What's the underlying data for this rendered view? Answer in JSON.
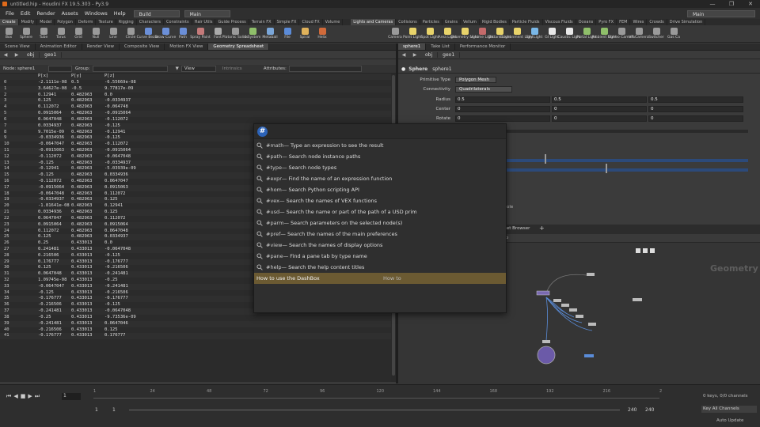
{
  "window": {
    "title": "untitled.hip - Houdini FX 19.5.303 - Py3.9",
    "controls": [
      "—",
      "❐",
      "✕"
    ]
  },
  "menu": {
    "items": [
      "File",
      "Edit",
      "Render",
      "Assets",
      "Windows",
      "Help"
    ],
    "desktop_left": "Build",
    "desktop_mid": "Main",
    "desktop_right": "Main"
  },
  "shelf_tabs_left": [
    "Create",
    "Modify",
    "Model",
    "Polygon",
    "Deform",
    "Texture",
    "Rigging",
    "Characters",
    "Constraints",
    "Hair Utils",
    "Guide Process",
    "Terrain FX",
    "Simple FX",
    "Cloud FX",
    "Volume"
  ],
  "shelf_tabs_right": [
    "Lights and Cameras",
    "Collisions",
    "Particles",
    "Grains",
    "Vellum",
    "Rigid Bodies",
    "Particle Fluids",
    "Viscous Fluids",
    "Oceans",
    "Pyro FX",
    "FEM",
    "Wires",
    "Crowds",
    "Drive Simulation"
  ],
  "tools_left": [
    {
      "label": "Box",
      "color": "#9a9a9a"
    },
    {
      "label": "Sphere",
      "color": "#9a9a9a"
    },
    {
      "label": "Tube",
      "color": "#9a9a9a"
    },
    {
      "label": "Torus",
      "color": "#9a9a9a"
    },
    {
      "label": "Grid",
      "color": "#9a9a9a"
    },
    {
      "label": "Null",
      "color": "#9a9a9a"
    },
    {
      "label": "Line",
      "color": "#9a9a9a"
    },
    {
      "label": "Circle",
      "color": "#9a9a9a"
    },
    {
      "label": "Curve Bezier",
      "color": "#6b8fd8"
    },
    {
      "label": "Draw Curve",
      "color": "#6b8fd8"
    },
    {
      "label": "Path",
      "color": "#6b8fd8"
    },
    {
      "label": "Spray Paint",
      "color": "#c47a7a"
    },
    {
      "label": "Font",
      "color": "#aaaaaa"
    },
    {
      "label": "Platonic Solids",
      "color": "#9a9a9a"
    },
    {
      "label": "L-System",
      "color": "#8fbf6a"
    },
    {
      "label": "Metaball",
      "color": "#7aa6d8"
    },
    {
      "label": "File",
      "color": "#5b8bd8"
    },
    {
      "label": "Spiral",
      "color": "#e0b25b"
    },
    {
      "label": "Helix",
      "color": "#d06a3a"
    }
  ],
  "tools_right": [
    {
      "label": "Camera",
      "color": "#9a9a9a"
    },
    {
      "label": "Point Light",
      "color": "#e8d36a"
    },
    {
      "label": "Spot Light",
      "color": "#e8d36a"
    },
    {
      "label": "Area Light",
      "color": "#e8d36a"
    },
    {
      "label": "Geometry Light",
      "color": "#e8d36a"
    },
    {
      "label": "Volume Light",
      "color": "#c46a6a"
    },
    {
      "label": "Distant Light",
      "color": "#e8d36a"
    },
    {
      "label": "Environment Light",
      "color": "#e8d36a"
    },
    {
      "label": "Sky Light",
      "color": "#7ab8e8"
    },
    {
      "label": "GI Light",
      "color": "#e8e8e8"
    },
    {
      "label": "Caustic Light",
      "color": "#e8e8e8"
    },
    {
      "label": "Portal Light",
      "color": "#8fbf6a"
    },
    {
      "label": "Ambient Light",
      "color": "#8fbf6a"
    },
    {
      "label": "Stereo Camera",
      "color": "#9a9a9a"
    },
    {
      "label": "VR Camera",
      "color": "#9a9a9a"
    },
    {
      "label": "Switcher",
      "color": "#9a9a9a"
    },
    {
      "label": "Gas Ca",
      "color": "#9a9a9a"
    }
  ],
  "left_pane": {
    "tabs": [
      "Scene View",
      "Animation Editor",
      "Render View",
      "Composite View",
      "Motion FX View",
      "Geometry Spreadsheet"
    ],
    "path": [
      "obj",
      "geo1"
    ],
    "node_label": "Node: sphere1",
    "group_label": "Group:",
    "view_label": "View",
    "intrinsics_label": "Intrinsics",
    "attributes_label": "Attributes:"
  },
  "spreadsheet": {
    "headers": [
      "",
      "P[x]",
      "P[y]",
      "P[z]"
    ],
    "rows": [
      [
        "0",
        "-2.1111e-08",
        "0.5",
        "-6.55669e-08"
      ],
      [
        "1",
        "3.64627e-08",
        "-0.5",
        "9.77817e-09"
      ],
      [
        "2",
        "0.12941",
        "0.482963",
        "0.0"
      ],
      [
        "3",
        "0.125",
        "0.482963",
        "-0.0334937"
      ],
      [
        "4",
        "0.112072",
        "0.482963",
        "-0.064748"
      ],
      [
        "5",
        "0.0915064",
        "0.482963",
        "-0.0915064"
      ],
      [
        "6",
        "0.0647048",
        "0.482963",
        "-0.112072"
      ],
      [
        "7",
        "0.0334937",
        "0.482963",
        "-0.125"
      ],
      [
        "8",
        "9.7015e-09",
        "0.482963",
        "-0.12941"
      ],
      [
        "9",
        "-0.0334936",
        "0.482963",
        "-0.125"
      ],
      [
        "10",
        "-0.0647047",
        "0.482963",
        "-0.112072"
      ],
      [
        "11",
        "-0.0915063",
        "0.482963",
        "-0.0915064"
      ],
      [
        "12",
        "-0.112072",
        "0.482963",
        "-0.0647048"
      ],
      [
        "13",
        "-0.125",
        "0.482963",
        "-0.0334937"
      ],
      [
        "14",
        "-0.12941",
        "0.482963",
        "-5.03939e-09"
      ],
      [
        "15",
        "-0.125",
        "0.482963",
        "0.0334936"
      ],
      [
        "16",
        "-0.112072",
        "0.482963",
        "0.0647047"
      ],
      [
        "17",
        "-0.0915064",
        "0.482963",
        "0.0915063"
      ],
      [
        "18",
        "-0.0647048",
        "0.482963",
        "0.112072"
      ],
      [
        "19",
        "-0.0334937",
        "0.482963",
        "0.125"
      ],
      [
        "20",
        "-1.81641e-08",
        "0.482963",
        "0.12941"
      ],
      [
        "21",
        "0.0334936",
        "0.482963",
        "0.125"
      ],
      [
        "22",
        "0.0647047",
        "0.482963",
        "0.112072"
      ],
      [
        "23",
        "0.0915064",
        "0.482963",
        "0.0915064"
      ],
      [
        "24",
        "0.112072",
        "0.482963",
        "0.0647048"
      ],
      [
        "25",
        "0.125",
        "0.482963",
        "0.0334937"
      ],
      [
        "26",
        "0.25",
        "0.433013",
        "0.0"
      ],
      [
        "27",
        "0.241481",
        "0.433013",
        "-0.0647048"
      ],
      [
        "28",
        "0.216506",
        "0.433013",
        "-0.125"
      ],
      [
        "29",
        "0.176777",
        "0.433013",
        "-0.176777"
      ],
      [
        "30",
        "0.125",
        "0.433013",
        "-0.216506"
      ],
      [
        "31",
        "0.0647048",
        "0.433013",
        "-0.241481"
      ],
      [
        "32",
        "1.09745e-08",
        "0.433013",
        "-0.25"
      ],
      [
        "33",
        "-0.0647047",
        "0.433013",
        "-0.241481"
      ],
      [
        "34",
        "-0.125",
        "0.433013",
        "-0.216506"
      ],
      [
        "35",
        "-0.176777",
        "0.433013",
        "-0.176777"
      ],
      [
        "36",
        "-0.216506",
        "0.433013",
        "-0.125"
      ],
      [
        "37",
        "-0.241481",
        "0.433013",
        "-0.0647048"
      ],
      [
        "38",
        "-0.25",
        "0.433013",
        "-9.73536e-09"
      ],
      [
        "39",
        "-0.241481",
        "0.433013",
        "0.0647046"
      ],
      [
        "40",
        "-0.216506",
        "0.433013",
        "0.125"
      ],
      [
        "41",
        "-0.176777",
        "0.433013",
        "0.176777"
      ]
    ]
  },
  "right_pane": {
    "tabs": [
      "sphere1",
      "Take List",
      "Performance Monitor"
    ],
    "path": [
      "obj",
      "geo1"
    ],
    "node_type": "Sphere",
    "node_name": "sphere1",
    "parms": {
      "primitive_type_label": "Primitive Type",
      "primitive_type_value": "Polygon Mesh",
      "connectivity_label": "Connectivity",
      "connectivity_value": "Quadrilaterals",
      "radius_label": "Radius",
      "radius": [
        "0.5",
        "0.5",
        "0.5"
      ],
      "center_label": "Center",
      "center": [
        "0",
        "0",
        "0"
      ],
      "rotate_label": "Rotate",
      "rotate": [
        "0",
        "0",
        "0"
      ],
      "partial_label": "ole"
    }
  },
  "network": {
    "tab_label": "set Browser",
    "path_label": "lp",
    "context_label": "Geometry"
  },
  "timeline": {
    "frame": "1",
    "ticks": [
      "1",
      "24",
      "48",
      "72",
      "96",
      "120",
      "144",
      "168",
      "192",
      "216",
      "2"
    ],
    "start": "1",
    "start2": "1",
    "end": "240",
    "end2": "240",
    "keys_label": "0 keys, 0/0 channels",
    "channels_label": "Key All Channels",
    "auto_update": "Auto Update"
  },
  "dashbox": {
    "query": "",
    "items": [
      {
        "key": "#math",
        "text": " — Type an expression to see the result"
      },
      {
        "key": "#path",
        "text": " — Search node instance paths"
      },
      {
        "key": "#type",
        "text": " — Search node types"
      },
      {
        "key": "#expr",
        "text": " — Find the name of an expression function"
      },
      {
        "key": "#hom",
        "text": " — Search Python scripting API"
      },
      {
        "key": "#vex",
        "text": " — Search the names of VEX functions"
      },
      {
        "key": "#usd",
        "text": " — Search the name or part of the path of a USD prim"
      },
      {
        "key": "#parm",
        "text": " — Search parameters on the selected node(s)"
      },
      {
        "key": "#pref",
        "text": " — Search the names of the main preferences"
      },
      {
        "key": "#view",
        "text": " — Search the names of display options"
      },
      {
        "key": "#pane",
        "text": " — Find a pane tab by type name"
      },
      {
        "key": "#help",
        "text": " — Search the help content titles"
      }
    ],
    "howto_label": "How to use the DashBox",
    "howto_tag": "How to"
  },
  "colors": {
    "accent": "#e06a1a",
    "selection": "#6b5a32",
    "dashbox_badge": "#2c63b8"
  }
}
